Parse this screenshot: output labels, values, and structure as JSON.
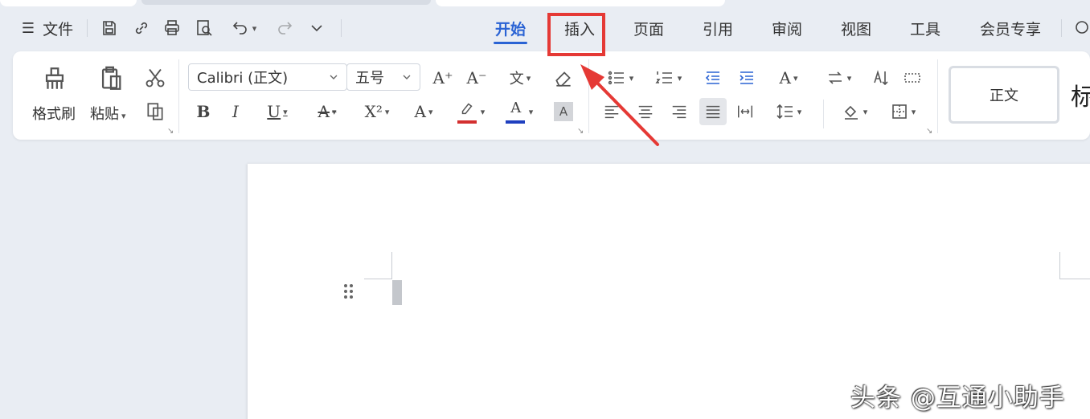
{
  "menubar": {
    "file_menu": "文件",
    "tabs": [
      {
        "label": "开始",
        "active": true
      },
      {
        "label": "插入",
        "active": false
      },
      {
        "label": "页面",
        "active": false
      },
      {
        "label": "引用",
        "active": false
      },
      {
        "label": "审阅",
        "active": false
      },
      {
        "label": "视图",
        "active": false
      },
      {
        "label": "工具",
        "active": false
      },
      {
        "label": "会员专享",
        "active": false
      }
    ]
  },
  "ribbon": {
    "format_painter": "格式刷",
    "paste": "粘贴",
    "font_name": "Calibri (正文)",
    "font_size": "五号",
    "bold": "B",
    "italic": "I",
    "underline": "U",
    "superscript": "X²",
    "style_normal": "正文",
    "style_next": "标"
  },
  "annotation": {
    "highlight_color": "#e53935"
  },
  "watermark": "头条 @互通小助手",
  "colors": {
    "accent": "#2a63d4",
    "font_color_bar": "#1f3fbf",
    "highlight_bar": "#d32f2f"
  }
}
